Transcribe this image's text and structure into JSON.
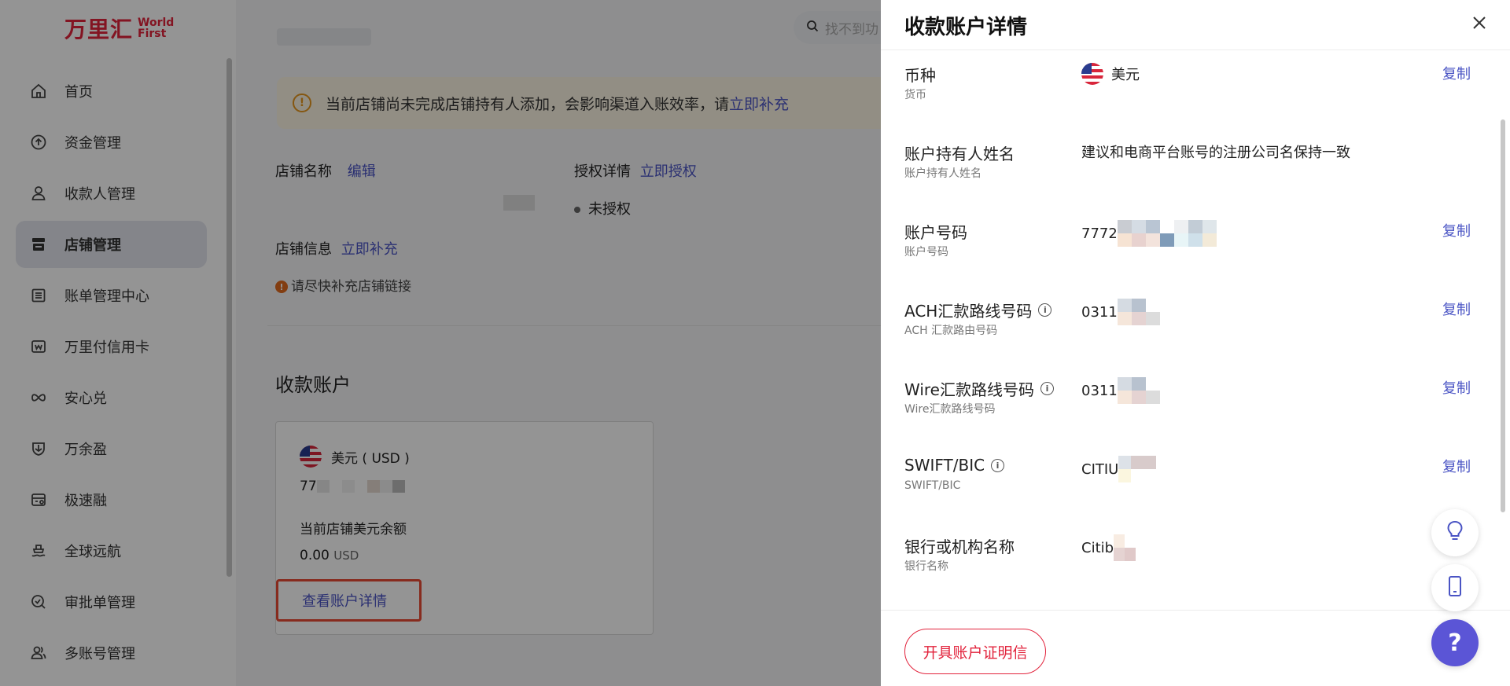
{
  "brand": {
    "name_cn": "万里汇",
    "name_en_line1": "World",
    "name_en_line2": "First"
  },
  "sidebar": {
    "items": [
      {
        "label": "首页",
        "icon": "home-icon"
      },
      {
        "label": "资金管理",
        "icon": "funds-icon"
      },
      {
        "label": "收款人管理",
        "icon": "payee-icon"
      },
      {
        "label": "店铺管理",
        "icon": "store-icon",
        "active": true
      },
      {
        "label": "账单管理中心",
        "icon": "bill-icon"
      },
      {
        "label": "万里付信用卡",
        "icon": "credit-card-icon"
      },
      {
        "label": "安心兑",
        "icon": "exchange-icon"
      },
      {
        "label": "万余盈",
        "icon": "savings-icon"
      },
      {
        "label": "极速融",
        "icon": "finance-icon"
      },
      {
        "label": "全球远航",
        "icon": "ship-icon"
      },
      {
        "label": "审批单管理",
        "icon": "approval-icon"
      },
      {
        "label": "多账号管理",
        "icon": "multi-account-icon"
      }
    ]
  },
  "header": {
    "search_placeholder": "找不到功"
  },
  "main": {
    "alert_text": "当前店铺尚未完成店铺持有人添加，会影响渠道入账效率，请",
    "alert_link": "立即补充",
    "store_name_label": "店铺名称",
    "store_name_edit": "编辑",
    "auth_label": "授权详情",
    "auth_link": "立即授权",
    "auth_status": "未授权",
    "store_info_label": "店铺信息",
    "store_info_link": "立即补充",
    "store_link_warning": "请尽快补充店铺链接",
    "section_title": "收款账户",
    "card": {
      "currency": "美元 ( USD )",
      "account_prefix": "77",
      "balance_label": "当前店铺美元余额",
      "balance_amount": "0.00",
      "balance_currency": "USD",
      "view_details": "查看账户详情"
    }
  },
  "drawer": {
    "title": "收款账户详情",
    "copy_label": "复制",
    "fields": [
      {
        "label": "币种",
        "sub": "货币",
        "value": "美元",
        "copy": true
      },
      {
        "label": "账户持有人姓名",
        "sub": "账户持有人姓名",
        "value": "建议和电商平台账号的注册公司名保持一致",
        "copy": false
      },
      {
        "label": "账户号码",
        "sub": "账户号码",
        "value": "7772",
        "copy": true
      },
      {
        "label": "ACH汇款路线号码",
        "sub": "ACH 汇款路由号码",
        "value": "0311",
        "copy": true,
        "info": true
      },
      {
        "label": "Wire汇款路线号码",
        "sub": "Wire汇款路线号码",
        "value": "0311",
        "copy": true,
        "info": true
      },
      {
        "label": "SWIFT/BIC",
        "sub": "SWIFT/BIC",
        "value": "CITIU",
        "copy": true,
        "info": true
      },
      {
        "label": "银行或机构名称",
        "sub": "银行名称",
        "value": "Citib",
        "copy": false
      }
    ],
    "cert_button": "开具账户证明信"
  },
  "colors": {
    "brand_red": "#e2233c",
    "link_blue": "#4a54c4",
    "alert_bg": "#fbf4e4"
  }
}
